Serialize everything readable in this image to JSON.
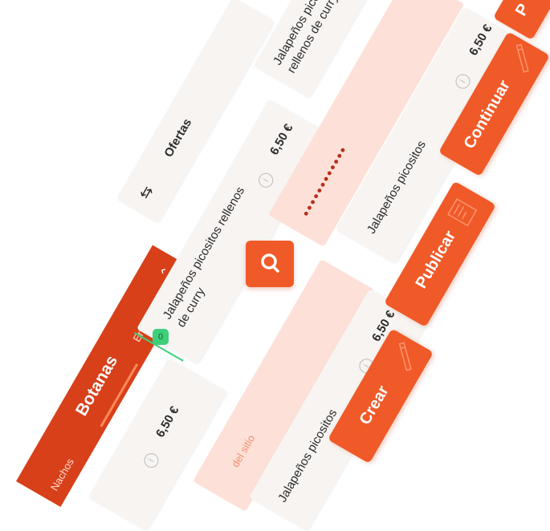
{
  "category_tabs": {
    "active": "Botanas",
    "items": [
      "Nachos",
      "Botanas",
      "Ensaladas"
    ]
  },
  "offers": {
    "label": "Ofertas"
  },
  "products": [
    {
      "name": "Jalapeños picositos rellenos de curry",
      "price": "6,50 €",
      "badge": "0"
    },
    {
      "name": "Jalapeños picositos",
      "price": "6,50 €"
    },
    {
      "name": "Jalapeños picositos",
      "price": "6,50 €"
    },
    {
      "name": "Jalapeños picositos rellenos de curry",
      "price": "6,50 €"
    },
    {
      "name": "",
      "price": "6,50 €"
    }
  ],
  "search": {
    "placeholder": "del sitio"
  },
  "password": {
    "mask": "••••••••••••"
  },
  "buttons": {
    "crear": "Crear",
    "publicar": "Publicar",
    "continuar": "Continuar",
    "top": "P"
  },
  "colors": {
    "accent": "#f05a28",
    "dark_accent": "#d8401a",
    "card": "#f7f4f2",
    "pink": "#fde1d8",
    "badge": "#3ecf7a"
  }
}
